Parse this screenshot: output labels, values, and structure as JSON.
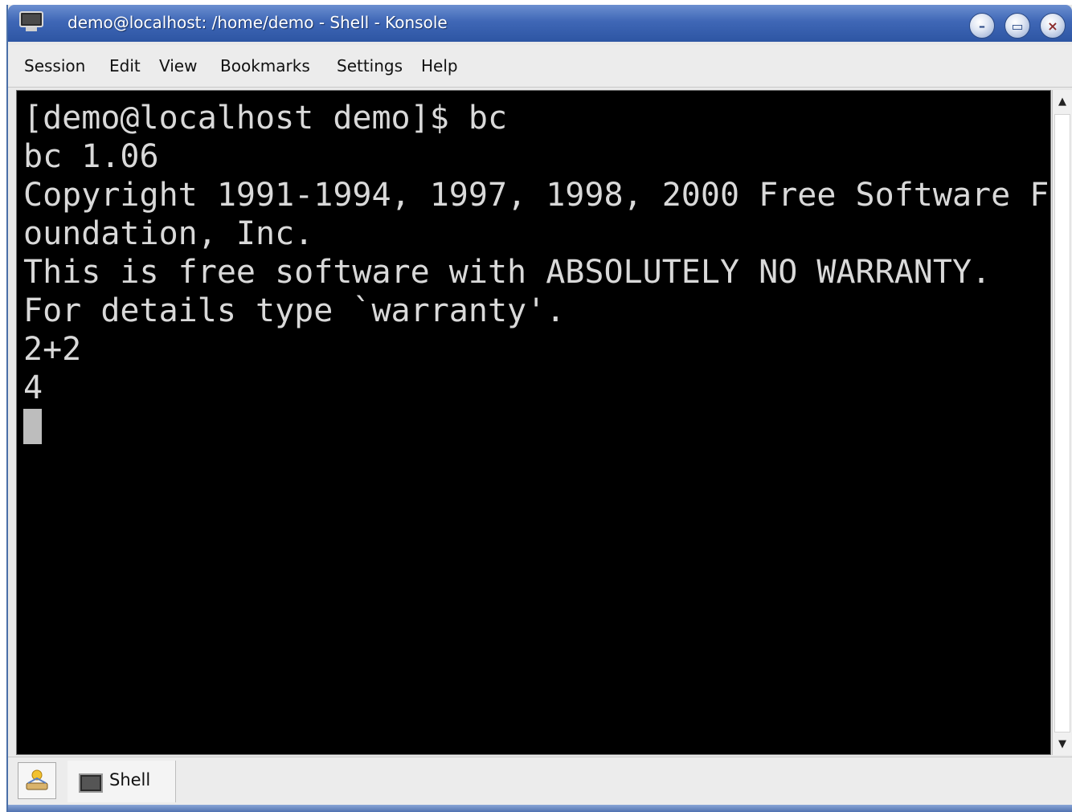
{
  "window": {
    "title": "demo@localhost: /home/demo - Shell - Konsole"
  },
  "menu": {
    "items": [
      "Session",
      "Edit",
      "View",
      "Bookmarks",
      "Settings",
      "Help"
    ]
  },
  "terminal": {
    "lines": [
      "[demo@localhost demo]$ bc",
      "bc 1.06",
      "Copyright 1991-1994, 1997, 1998, 2000 Free Software F",
      "oundation, Inc.",
      "This is free software with ABSOLUTELY NO WARRANTY.",
      "For details type `warranty'.",
      "2+2",
      "4"
    ]
  },
  "tabs": {
    "items": [
      {
        "label": "Shell"
      }
    ]
  },
  "colors": {
    "titlebar": "#3f67b6",
    "terminal_bg": "#000000",
    "terminal_fg": "#d9d9d9",
    "cursor": "#bdbdbd"
  }
}
